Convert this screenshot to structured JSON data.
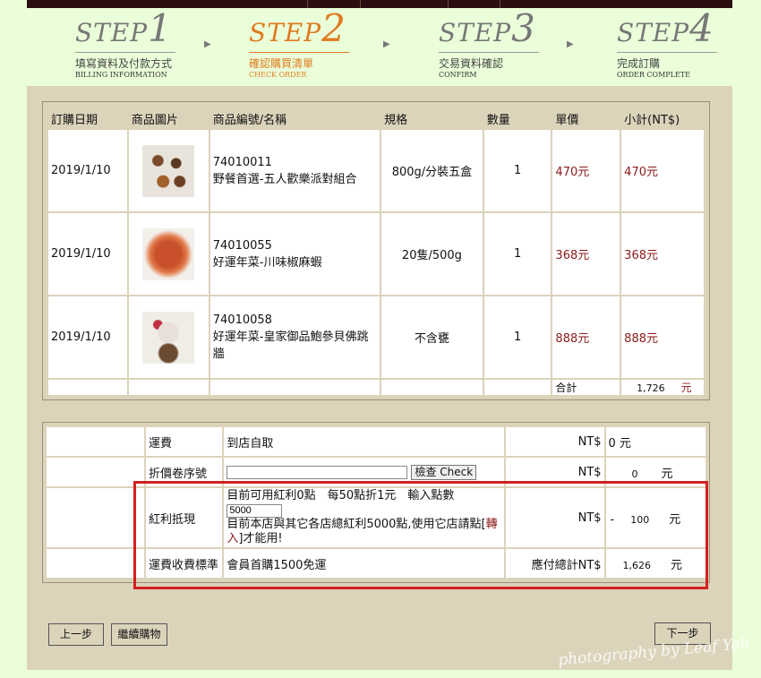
{
  "steps": [
    {
      "word": "STEP",
      "num": "1",
      "zh": "填寫資料及付款方式",
      "en": "BILLING INFORMATION"
    },
    {
      "word": "STEP",
      "num": "2",
      "zh": "確認購買清單",
      "en": "CHECK ORDER"
    },
    {
      "word": "STEP",
      "num": "3",
      "zh": "交易資料確認",
      "en": "CONFIRM"
    },
    {
      "word": "STEP",
      "num": "4",
      "zh": "完成訂購",
      "en": "ORDER COMPLETE"
    }
  ],
  "step_arrow": "▶",
  "order": {
    "headers": {
      "date": "訂購日期",
      "image": "商品圖片",
      "name": "商品編號/名稱",
      "spec": "規格",
      "qty": "數量",
      "price": "單價",
      "subtotal": "小計(NT$)"
    },
    "rows": [
      {
        "date": "2019/1/10",
        "code": "74010011",
        "name": "野餐首選-五人歡樂派對組合",
        "spec": "800g/分裝五盒",
        "qty": "1",
        "price": "470元",
        "subtotal": "470元"
      },
      {
        "date": "2019/1/10",
        "code": "74010055",
        "name": "好運年菜-川味椒麻蝦",
        "spec": "20隻/500g",
        "qty": "1",
        "price": "368元",
        "subtotal": "368元"
      },
      {
        "date": "2019/1/10",
        "code": "74010058",
        "name": "好運年菜-皇家御品鮑參貝佛跳牆",
        "spec": "不含甕",
        "qty": "1",
        "price": "888元",
        "subtotal": "888元"
      }
    ],
    "total_label": "合計",
    "total_value": "1,726",
    "total_unit": "元"
  },
  "fees": {
    "shipping_label": "運費",
    "shipping_value": "到店自取",
    "shipping_currency": "NT$",
    "shipping_amount": "0 元",
    "coupon_label": "折價卷序號",
    "coupon_button": "檢查 Check",
    "coupon_currency": "NT$",
    "coupon_amount": "0",
    "coupon_unit": "元",
    "bonus_label": "紅利抵現",
    "bonus_line1": "目前可用紅利0點　每50點折1元　輸入點數",
    "bonus_input": "5000",
    "bonus_line2a": "目前本店與其它各店總紅利5000點,使用它店請點[",
    "bonus_link": "轉入",
    "bonus_line2b": "]才能用!",
    "bonus_currency": "NT$",
    "bonus_sign": "-",
    "bonus_amount": "100",
    "bonus_unit": "元",
    "standard_label": "運費收費標準",
    "standard_value": "會員首購1500免運",
    "grand_label": "應付總計NT$",
    "grand_amount": "1,626",
    "grand_unit": "元"
  },
  "nav": {
    "prev": "上一步",
    "continue": "繼續購物",
    "next": "下一步"
  },
  "watermark": "photography by Leaf Yeh",
  "colors": {
    "active_step": "#e07a20",
    "price": "#8b1a1a",
    "highlight": "#d42020"
  }
}
